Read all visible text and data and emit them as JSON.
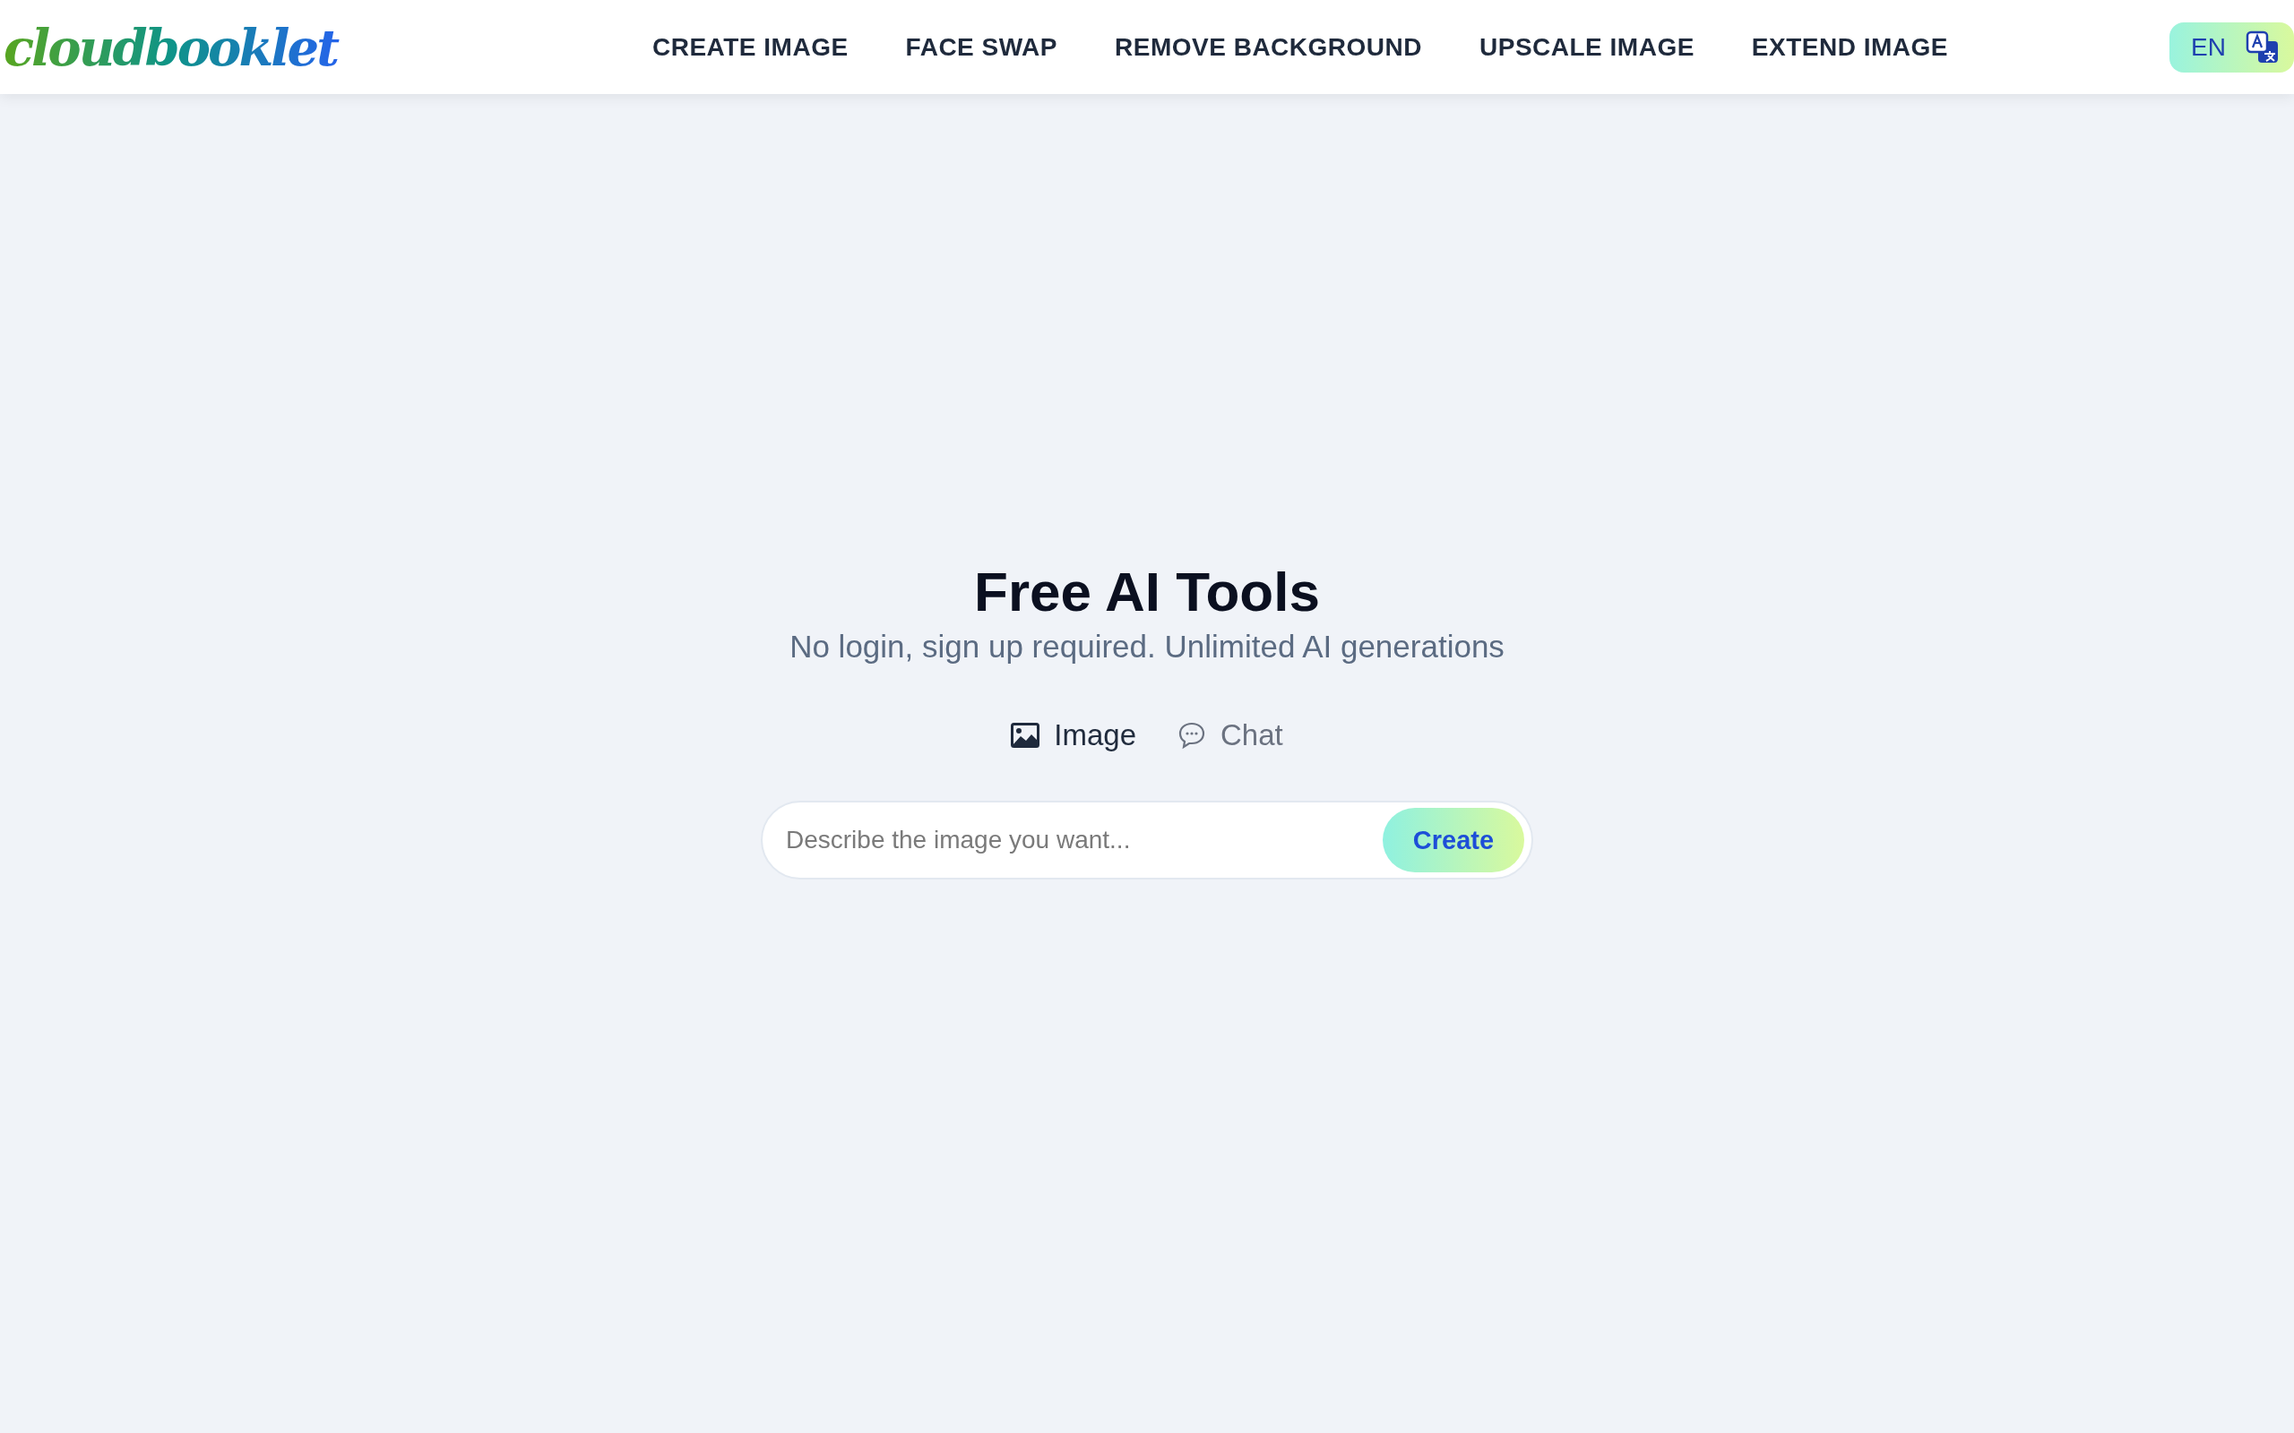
{
  "header": {
    "logo": "cloudbooklet",
    "nav": [
      {
        "label": "CREATE IMAGE"
      },
      {
        "label": "FACE SWAP"
      },
      {
        "label": "REMOVE BACKGROUND"
      },
      {
        "label": "UPSCALE IMAGE"
      },
      {
        "label": "EXTEND IMAGE"
      }
    ],
    "language": "EN"
  },
  "hero": {
    "title": "Free AI Tools",
    "subtitle": "No login, sign up required. Unlimited AI generations"
  },
  "modes": [
    {
      "label": "Image",
      "kind": "image",
      "selected": true
    },
    {
      "label": "Chat",
      "kind": "chat",
      "selected": false
    }
  ],
  "prompt": {
    "placeholder": "Describe the image you want...",
    "button": "Create"
  }
}
